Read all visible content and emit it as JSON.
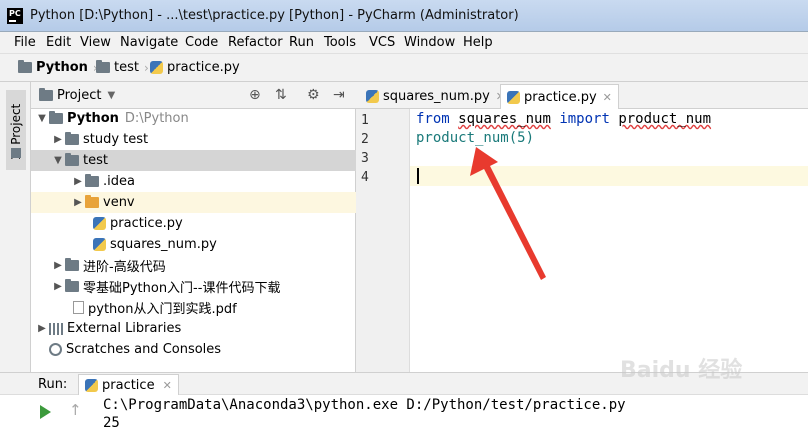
{
  "window": {
    "title": "Python [D:\\Python] - ...\\test\\practice.py [Python] - PyCharm (Administrator)",
    "logo": "PC"
  },
  "menu": [
    "File",
    "Edit",
    "View",
    "Navigate",
    "Code",
    "Refactor",
    "Run",
    "Tools",
    "VCS",
    "Window",
    "Help"
  ],
  "breadcrumb": [
    "Python",
    "test",
    "practice.py"
  ],
  "left_tool": {
    "label": "1: Project"
  },
  "project": {
    "header_label": "Project",
    "tree": [
      {
        "label": "Python",
        "extra": "D:\\Python",
        "icon": "folder-icon"
      },
      {
        "label": "study test",
        "icon": "folder-icon"
      },
      {
        "label": "test",
        "icon": "folder-icon"
      },
      {
        "label": ".idea",
        "icon": "folder-icon"
      },
      {
        "label": "venv",
        "icon": "folder-orange-icon"
      },
      {
        "label": "practice.py",
        "icon": "python-file-icon"
      },
      {
        "label": "squares_num.py",
        "icon": "python-file-icon"
      },
      {
        "label": "进阶-高级代码",
        "icon": "folder-icon"
      },
      {
        "label": "零基础Python入门--课件代码下载",
        "icon": "folder-icon"
      },
      {
        "label": "python从入门到实践.pdf",
        "icon": "pdf-file-icon"
      },
      {
        "label": "External Libraries",
        "icon": "library-icon"
      },
      {
        "label": "Scratches and Consoles",
        "icon": "scratches-icon"
      }
    ]
  },
  "editor": {
    "tabs": [
      {
        "label": "squares_num.py",
        "active": false
      },
      {
        "label": "practice.py",
        "active": true
      }
    ],
    "line_numbers": [
      "1",
      "2",
      "3",
      "4"
    ],
    "code": {
      "l1_kw1": "from",
      "l1_mod": "squares_num",
      "l1_kw2": "import",
      "l1_name": "product_num",
      "l2": "product_num(5)"
    }
  },
  "run": {
    "label": "Run:",
    "tab": "practice",
    "output": [
      "C:\\ProgramData\\Anaconda3\\python.exe D:/Python/test/practice.py",
      "25"
    ]
  },
  "watermark": "Baidu 经验",
  "colors": {
    "keyword": "#0033b3",
    "function": "#1a7a7a",
    "arrow": "#e83a2e",
    "selection": "#d5d5d5"
  }
}
